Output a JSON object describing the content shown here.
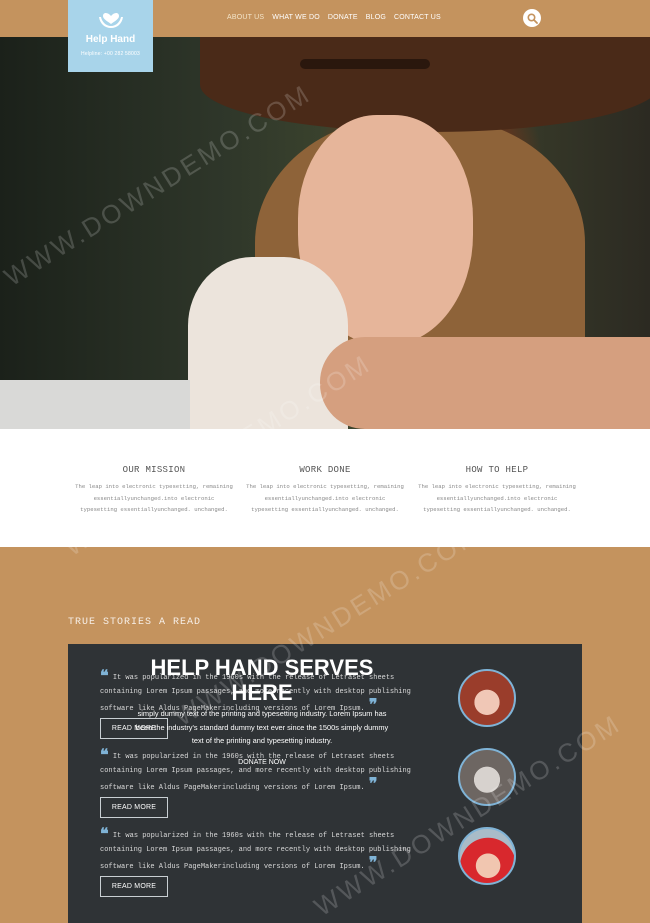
{
  "brand": {
    "title": "Help Hand",
    "phone": "Helpline: +00 282 58003",
    "logo_icon": "heart-hands-icon",
    "logo_bg": "#a8d4ea"
  },
  "nav": {
    "items": [
      "ABOUT US",
      "WHAT WE DO",
      "DONATE",
      "BLOG",
      "CONTACT US"
    ],
    "active": "ABOUT US",
    "search_icon": "search-icon"
  },
  "colors": {
    "header_bg": "#c4935e",
    "panel_bg": "#2f3336",
    "accent": "#7fb3d6"
  },
  "mission": [
    {
      "title": "OUR MISSION",
      "text": "The leap into electronic typesetting, remaining essentiallyunchanged.into electronic typesetting essentiallyunchanged. unchanged."
    },
    {
      "title": "WORK DONE",
      "text": "The leap into electronic typesetting, remaining essentiallyunchanged.into electronic typesetting essentiallyunchanged. unchanged."
    },
    {
      "title": "HOW TO HELP",
      "text": "The leap into electronic typesetting, remaining essentiallyunchanged.into electronic typesetting essentiallyunchanged. unchanged."
    }
  ],
  "stories": {
    "title": "TRUE STORIES A READ",
    "items": [
      {
        "text": "It was popularized in the 1960s with the release of Letraset sheets containing Lorem Ipsum passages, and more recently with desktop publishing software like Aldus PageMakerincluding versions of Lorem Ipsum.",
        "button": "READ MORE"
      },
      {
        "text": "It was popularized in the 1960s with the release of Letraset sheets containing Lorem Ipsum passages, and more recently with desktop publishing software like Aldus PageMakerincluding versions of Lorem Ipsum.",
        "button": "READ MORE"
      },
      {
        "text": "It was popularized in the 1960s with the release of Letraset sheets containing Lorem Ipsum passages, and more recently with desktop publishing software like Aldus PageMakerincluding versions of Lorem Ipsum.",
        "button": "READ MORE"
      }
    ]
  },
  "banner": {
    "heading": "HELP HAND SERVES HERE",
    "text": "simply dummy text of the printing and typesetting industry. Lorem Ipsum has been the industry's standard dummy text ever since the 1500s simply dummy text of the printing and typesetting industry.",
    "button": "DONATE NOW"
  },
  "watermark": "WWW.DOWNDEMO.COM"
}
